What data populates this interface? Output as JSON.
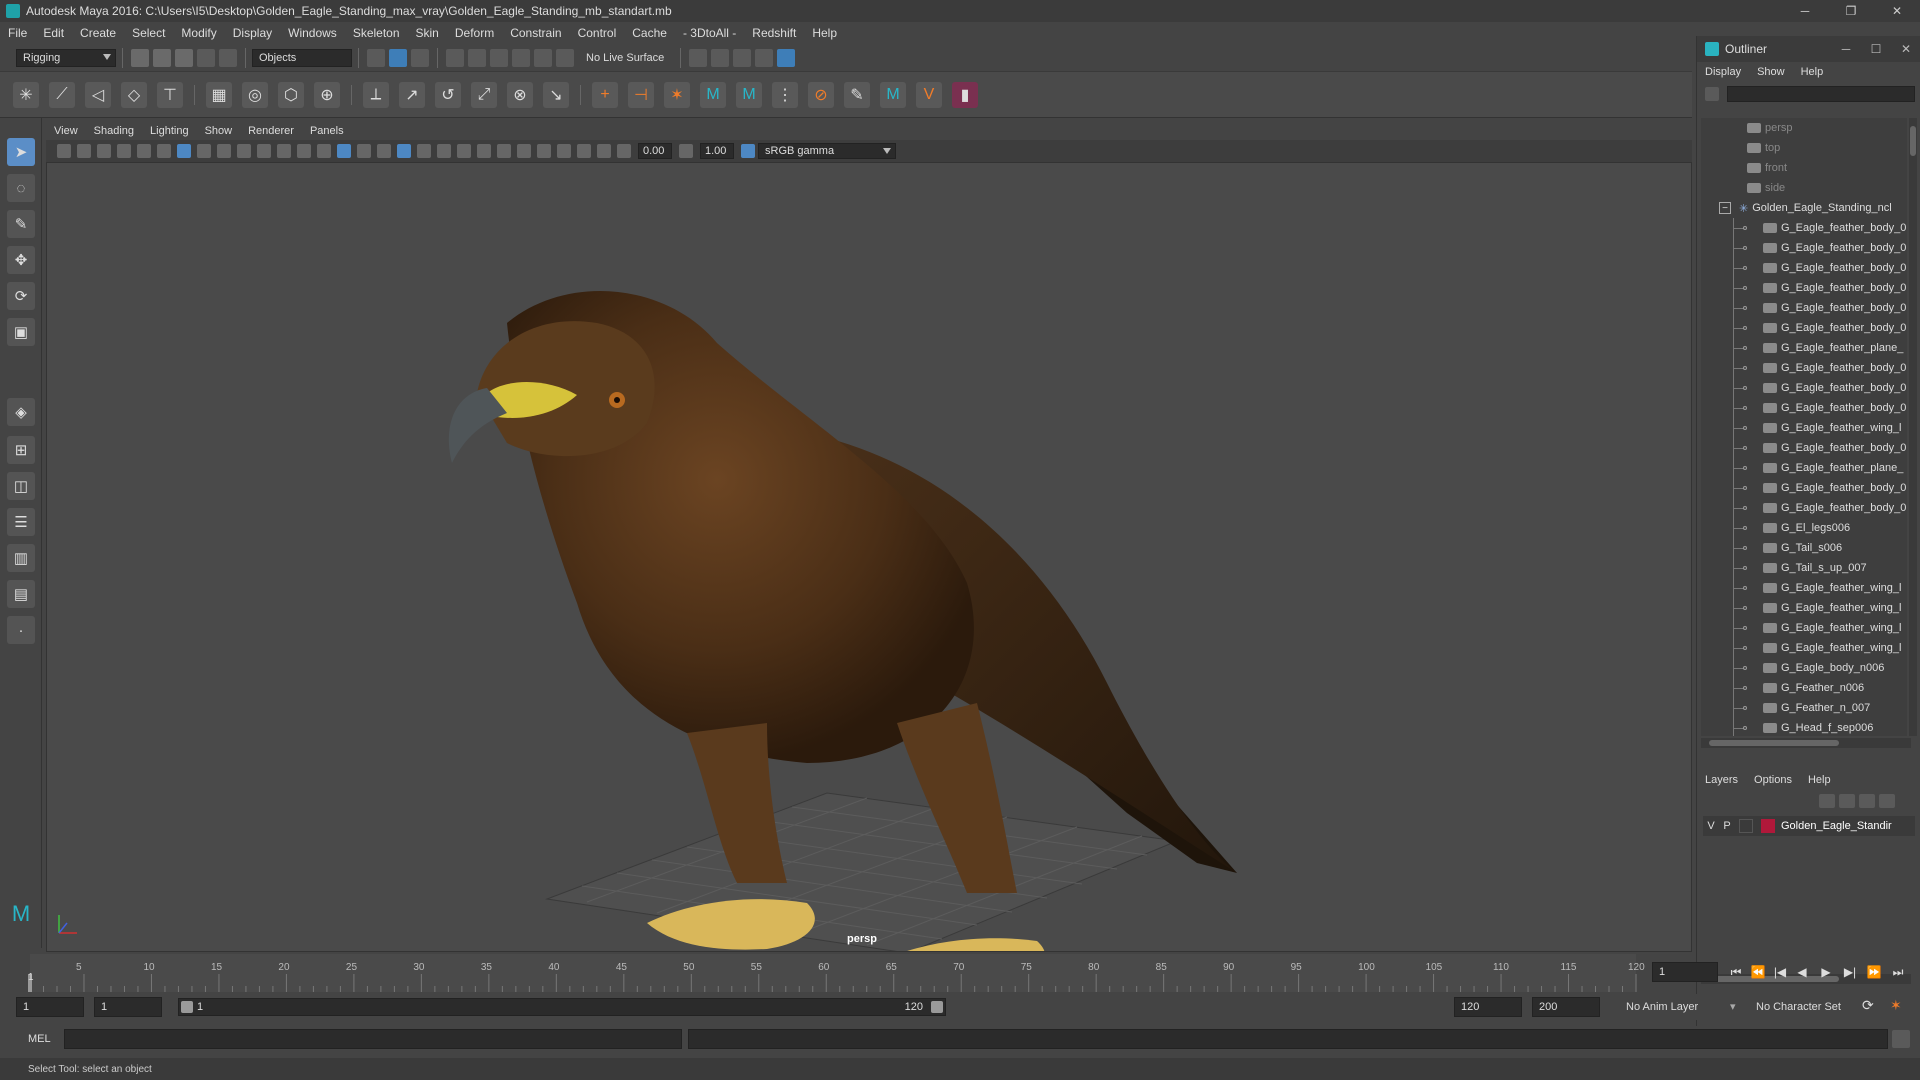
{
  "window": {
    "title": "Autodesk Maya 2016: C:\\Users\\I5\\Desktop\\Golden_Eagle_Standing_max_vray\\Golden_Eagle_Standing_mb_standart.mb",
    "minimize": "─",
    "restore": "❐",
    "close": "✕"
  },
  "menubar": [
    "File",
    "Edit",
    "Create",
    "Select",
    "Modify",
    "Display",
    "Windows",
    "Skeleton",
    "Skin",
    "Deform",
    "Constrain",
    "Control",
    "Cache",
    "- 3DtoAll -",
    "Redshift",
    "Help"
  ],
  "status": {
    "mode": "Rigging",
    "selection_mask": "Objects",
    "live_surface": "No Live Surface"
  },
  "viewport": {
    "menu": [
      "View",
      "Shading",
      "Lighting",
      "Show",
      "Renderer",
      "Panels"
    ],
    "exposure": "0.00",
    "gamma": "1.00",
    "colorspace": "sRGB gamma",
    "camera_label": "persp"
  },
  "outliner": {
    "title": "Outliner",
    "menu": [
      "Display",
      "Show",
      "Help"
    ],
    "cameras": [
      "persp",
      "top",
      "front",
      "side"
    ],
    "group": "Golden_Eagle_Standing_ncl",
    "items": [
      "G_Eagle_feather_body_0",
      "G_Eagle_feather_body_0",
      "G_Eagle_feather_body_0",
      "G_Eagle_feather_body_0",
      "G_Eagle_feather_body_0",
      "G_Eagle_feather_body_0",
      "G_Eagle_feather_plane_",
      "G_Eagle_feather_body_0",
      "G_Eagle_feather_body_0",
      "G_Eagle_feather_body_0",
      "G_Eagle_feather_wing_l",
      "G_Eagle_feather_body_0",
      "G_Eagle_feather_plane_",
      "G_Eagle_feather_body_0",
      "G_Eagle_feather_body_0",
      "G_El_legs006",
      "G_Tail_s006",
      "G_Tail_s_up_007",
      "G_Eagle_feather_wing_l",
      "G_Eagle_feather_wing_l",
      "G_Eagle_feather_wing_l",
      "G_Eagle_feather_wing_l",
      "G_Eagle_body_n006",
      "G_Feather_n006",
      "G_Feather_n_007",
      "G_Head_f_sep006"
    ]
  },
  "layers": {
    "menu": [
      "Layers",
      "Options",
      "Help"
    ],
    "row": {
      "v": "V",
      "p": "P",
      "name": "Golden_Eagle_Standir"
    },
    "color": "#b0183a"
  },
  "timeline": {
    "ticks": [
      "5",
      "10",
      "15",
      "20",
      "25",
      "30",
      "35",
      "40",
      "45",
      "50",
      "55",
      "60",
      "65",
      "70",
      "75",
      "80",
      "85",
      "90",
      "95",
      "100",
      "105",
      "110",
      "115",
      "120"
    ],
    "start_label": "1",
    "current_frame": "1"
  },
  "range": {
    "start": "1",
    "playback_start": "1",
    "slider_start": "1",
    "slider_end": "120",
    "playback_end": "120",
    "end": "200",
    "anim_layer": "No Anim Layer",
    "char_set": "No Character Set"
  },
  "command": {
    "lang": "MEL"
  },
  "statusline": {
    "text": "Select Tool: select an object"
  }
}
